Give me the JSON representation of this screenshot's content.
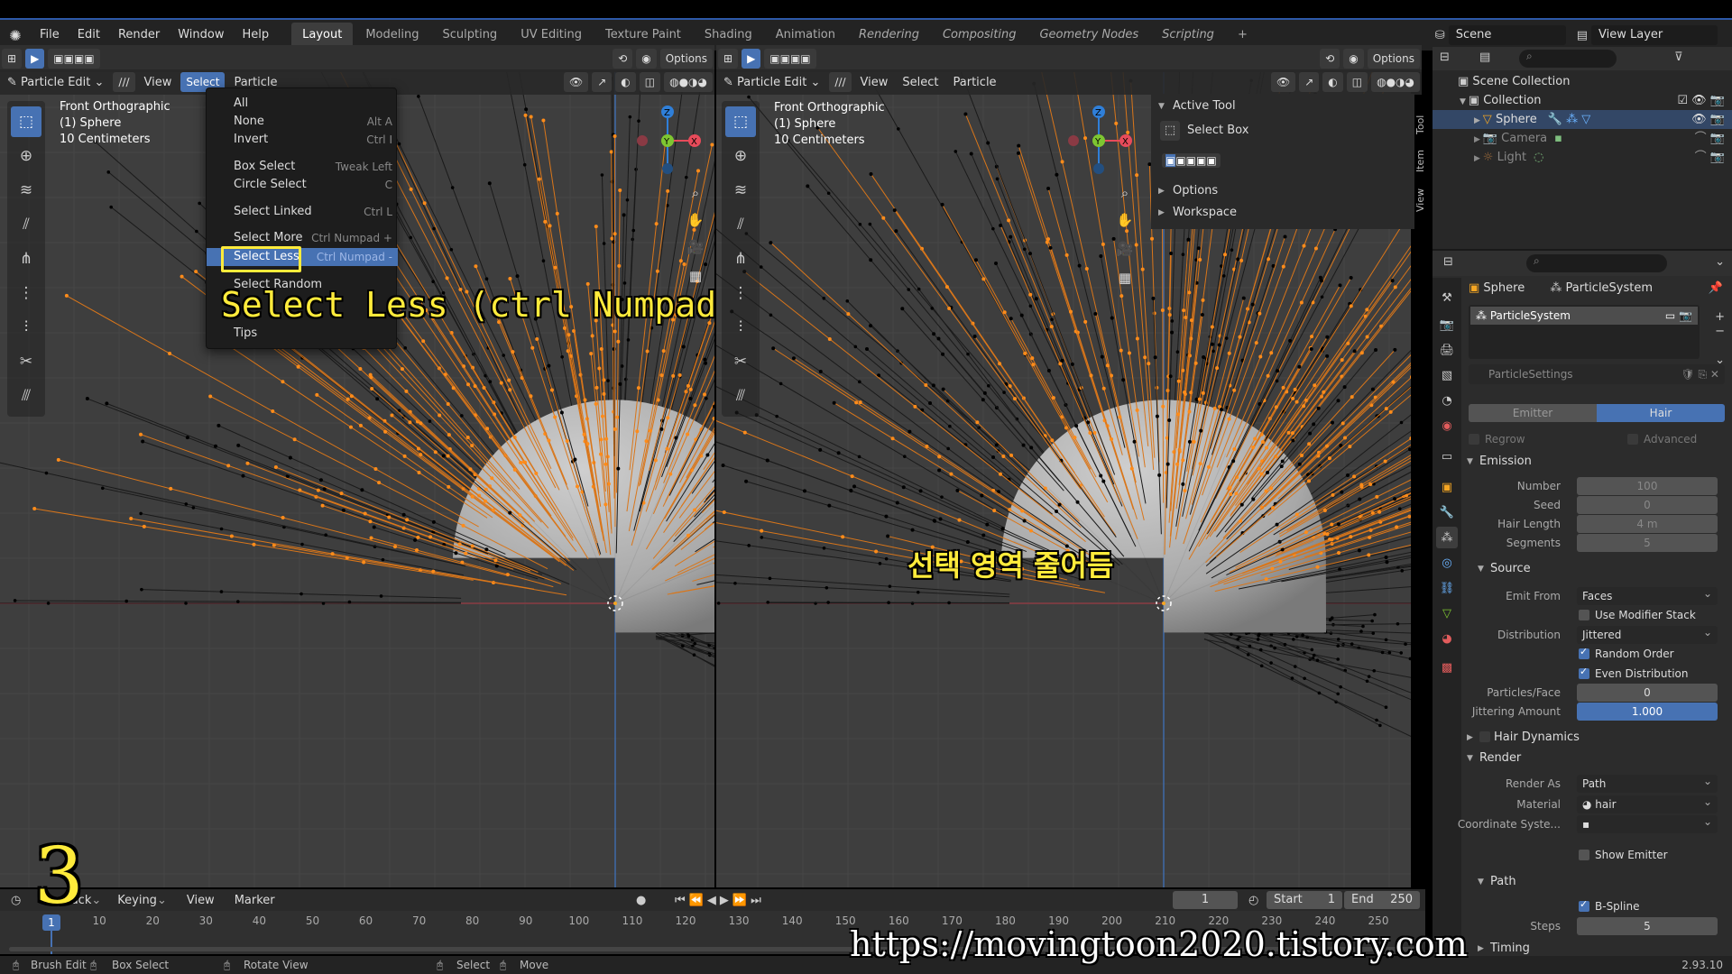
{
  "app": {
    "menus": [
      "File",
      "Edit",
      "Render",
      "Window",
      "Help"
    ],
    "workspaces": [
      "Layout",
      "Modeling",
      "Sculpting",
      "UV Editing",
      "Texture Paint",
      "Shading",
      "Animation",
      "Rendering",
      "Compositing",
      "Geometry Nodes",
      "Scripting"
    ],
    "active_workspace": "Layout",
    "add_workspace": "+",
    "scene": "Scene",
    "view_layer": "View Layer"
  },
  "viewport_left": {
    "header": {
      "mode": "Particle Edit",
      "view": "View",
      "select": "Select",
      "particle": "Particle",
      "options": "Options"
    },
    "info": {
      "view": "Front Orthographic",
      "object": "(1) Sphere",
      "scale": "10 Centimeters"
    }
  },
  "viewport_right": {
    "header": {
      "mode": "Particle Edit",
      "view": "View",
      "select": "Select",
      "particle": "Particle",
      "options": "Options"
    },
    "info": {
      "view": "Front Orthographic",
      "object": "(1) Sphere",
      "scale": "10 Centimeters"
    }
  },
  "select_menu": {
    "items": [
      {
        "label": "All",
        "shortcut": ""
      },
      {
        "label": "None",
        "shortcut": "Alt A"
      },
      {
        "label": "Invert",
        "shortcut": "Ctrl I"
      },
      {
        "label": "Box Select",
        "shortcut": "Tweak Left"
      },
      {
        "label": "Circle Select",
        "shortcut": "C"
      },
      {
        "label": "Select Linked",
        "shortcut": "Ctrl L"
      },
      {
        "label": "Select More",
        "shortcut": "Ctrl Numpad +"
      },
      {
        "label": "Select Less",
        "shortcut": "Ctrl Numpad -"
      },
      {
        "label": "Select Random",
        "shortcut": ""
      },
      {
        "label": "Tips",
        "shortcut": ""
      }
    ]
  },
  "captions": {
    "left": "Select Less (ctrl Numpad -)",
    "right": "선택 영역 줄어듬",
    "step": "3",
    "watermark": "https://movingtoon2020.tistory.com"
  },
  "n_panel": {
    "active_tool": "Active Tool",
    "select_box": "Select Box",
    "options": "Options",
    "workspace": "Workspace",
    "tabs": [
      "Tool",
      "Item",
      "View"
    ]
  },
  "outliner": {
    "scene_collection": "Scene Collection",
    "collection": "Collection",
    "objects": [
      "Sphere",
      "Camera",
      "Light"
    ]
  },
  "properties": {
    "object": "Sphere",
    "particle_system": "ParticleSystem",
    "system_list_item": "ParticleSystem",
    "settings": "ParticleSettings",
    "type_emitter": "Emitter",
    "type_hair": "Hair",
    "regrow": "Regrow",
    "advanced": "Advanced",
    "emission": {
      "title": "Emission",
      "number_label": "Number",
      "number": "100",
      "seed_label": "Seed",
      "seed": "0",
      "hair_length_label": "Hair Length",
      "hair_length": "4 m",
      "segments_label": "Segments",
      "segments": "5"
    },
    "source": {
      "title": "Source",
      "emit_from_label": "Emit From",
      "emit_from": "Faces",
      "use_modifier_stack": "Use Modifier Stack",
      "distribution_label": "Distribution",
      "distribution": "Jittered",
      "random_order": "Random Order",
      "even_distribution": "Even Distribution",
      "particles_face_label": "Particles/Face",
      "particles_face": "0",
      "jittering_label": "Jittering Amount",
      "jittering": "1.000"
    },
    "hair_dynamics": "Hair Dynamics",
    "render": {
      "title": "Render",
      "render_as_label": "Render As",
      "render_as": "Path",
      "material_label": "Material",
      "material": "hair",
      "coord_label": "Coordinate Syste...",
      "show_emitter": "Show Emitter"
    },
    "path": {
      "title": "Path",
      "bspline": "B-Spline",
      "steps_label": "Steps",
      "steps": "5"
    },
    "timing": "Timing"
  },
  "timeline": {
    "playback": "Playback",
    "keying": "Keying",
    "view": "View",
    "marker": "Marker",
    "current_frame": "1",
    "start_label": "Start",
    "start": "1",
    "end_label": "End",
    "end": "250",
    "ticks": [
      "1",
      "10",
      "20",
      "30",
      "40",
      "50",
      "60",
      "70",
      "80",
      "90",
      "100",
      "110",
      "120",
      "130",
      "140",
      "150",
      "160",
      "170",
      "180",
      "190",
      "200",
      "210",
      "220",
      "230",
      "240",
      "250"
    ]
  },
  "statusbar": {
    "brush_edit": "Brush Edit",
    "box_select": "Box Select",
    "rotate_view": "Rotate View",
    "select": "Select",
    "move": "Move",
    "version": "2.93.10"
  },
  "colors": {
    "accent": "#4772b3",
    "hair_selected": "#ff8c1a",
    "caption": "#ffeb3b"
  }
}
